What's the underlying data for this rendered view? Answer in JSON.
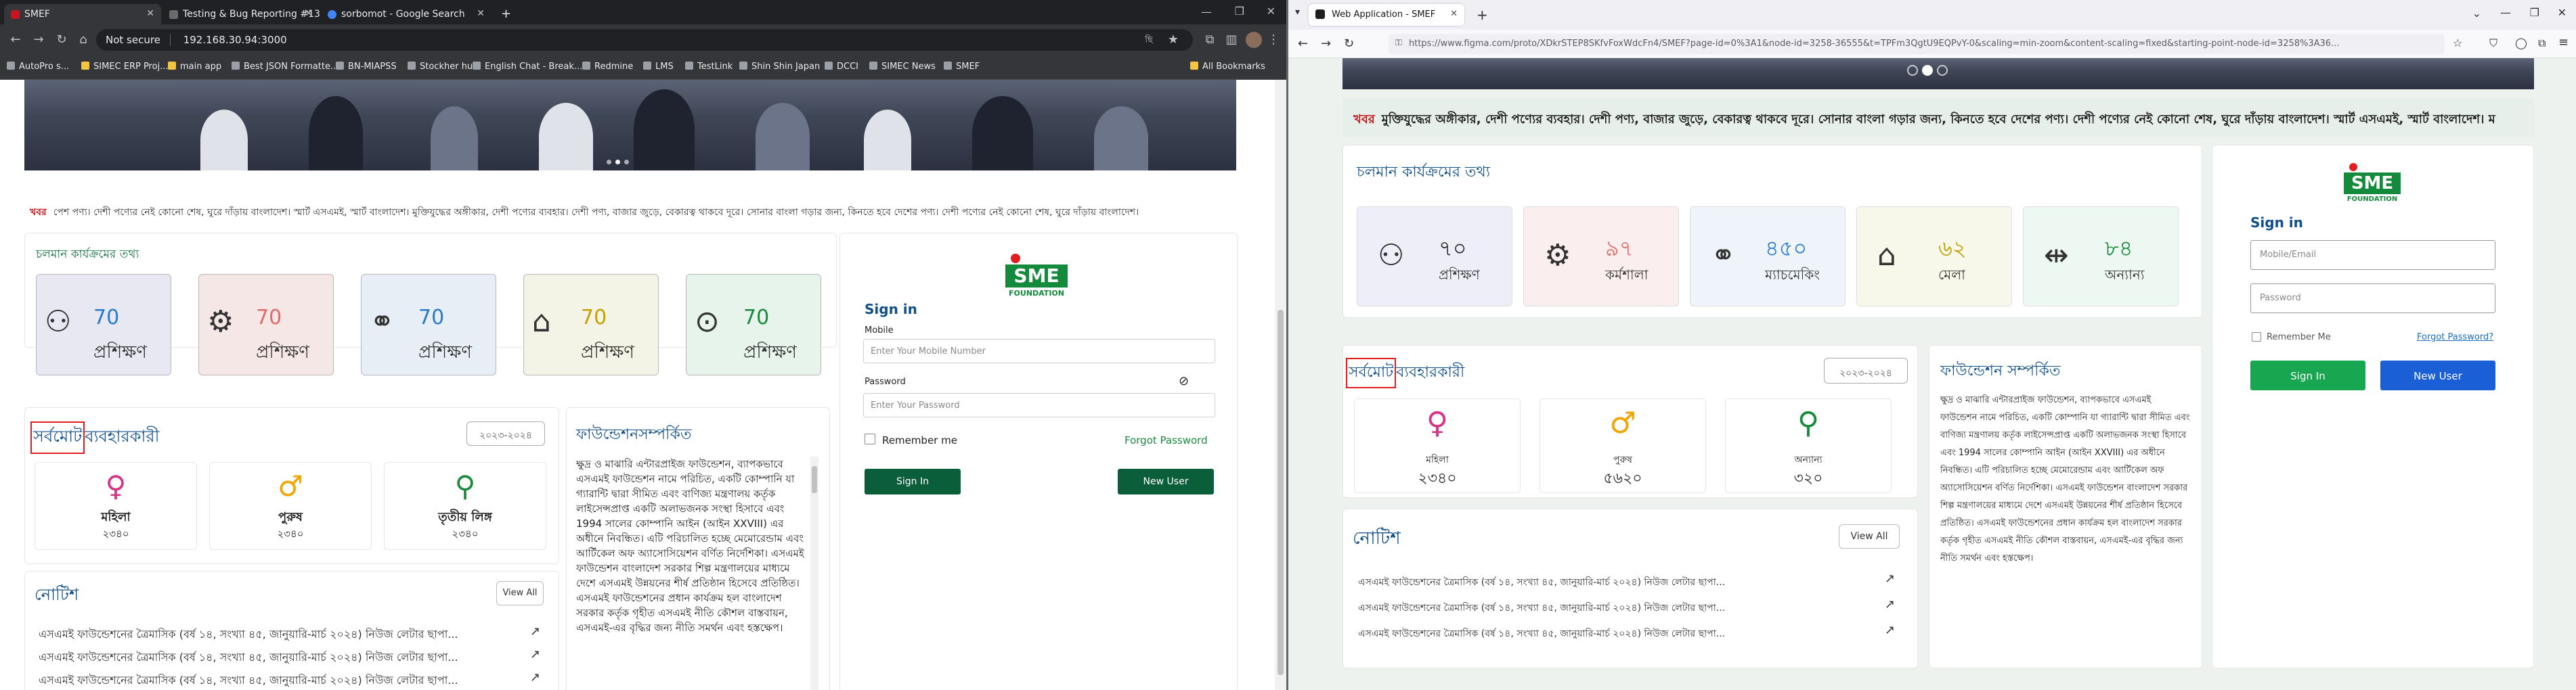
{
  "left_browser": {
    "tabs": [
      {
        "title": "SMEF"
      },
      {
        "title": "Testing & Bug Reporting #130..."
      },
      {
        "title": "sorbomot - Google Search"
      }
    ],
    "address": {
      "security": "Not secure",
      "url": "192.168.30.94:3000"
    },
    "profile": "ছি",
    "bookmarks": [
      "AutoPro s...",
      "SIMEC ERP Proj...",
      "main app",
      "Best JSON Formatte...",
      "BN-MIAPSS",
      "Stockher hub",
      "English Chat - Break...",
      "Redmine",
      "LMS",
      "TestLink",
      "Shin Shin Japan",
      "DCCI",
      "SIMEC News",
      "SMEF"
    ],
    "all_bookmarks": "All Bookmarks"
  },
  "left_page": {
    "ticker_label": "খবর",
    "ticker_text": "পেশ পণ্য। দেশী পণ্যের নেই কোনো শেষ, ঘুরে দাঁড়ায় বাংলাদেশ। স্মার্ট এসএমই, স্মার্ট বাংলাদেশ। মুক্তিযুদ্ধের অঙ্গীকার, দেশী পণ্যের ব্যবহার। দেশী পণ্য, বাজার জুড়ে, বেকারত্ব থাকবে দূরে। সোনার বাংলা গড়ার জন্য, কিনতে হবে দেশের পণ্য। দেশী পণ্যের নেই কোনো শেষ, ঘুরে দাঁড়ায় বাংলাদেশ।",
    "programs_title": "চলমান কার্যক্রমের তথ্য",
    "programs": [
      {
        "icon": "training-icon",
        "value": "70",
        "label": "প্রশিক্ষণ"
      },
      {
        "icon": "workshop-icon",
        "value": "70",
        "label": "প্রশিক্ষণ"
      },
      {
        "icon": "matchmaking-icon",
        "value": "70",
        "label": "প্রশিক্ষণ"
      },
      {
        "icon": "fair-icon",
        "value": "70",
        "label": "প্রশিক্ষণ"
      },
      {
        "icon": "others-icon",
        "value": "70",
        "label": "প্রশিক্ষণ"
      }
    ],
    "users_title_boxed": "সর্বমোট",
    "users_title_rest": "ব্যবহারকারী",
    "year": "২০২৩-২০২৪",
    "stats": [
      {
        "icon": "female-icon",
        "icon_glyph": "♀",
        "label": "মহিলা",
        "value": "২৩৪০",
        "color": "#d63384"
      },
      {
        "icon": "male-icon",
        "icon_glyph": "♂",
        "label": "পুরুষ",
        "value": "২৩৪০",
        "color": "#f0a500"
      },
      {
        "icon": "third-gender-icon",
        "icon_glyph": "⚲",
        "label": "তৃতীয় লিঙ্গ",
        "value": "২৩৪০",
        "color": "#1a8a3d"
      }
    ],
    "notice_title": "নোটিশ",
    "view_all": "View All",
    "notices": [
      "এসএমই ফাউন্ডেশনের ত্রৈমাসিক (বর্ষ ১৪, সংখ্যা ৪৫, জানুয়ারি-মার্চ ২০২৪) নিউজ লেটার ছাপা...",
      "এসএমই ফাউন্ডেশনের ত্রৈমাসিক (বর্ষ ১৪, সংখ্যা ৪৫, জানুয়ারি-মার্চ ২০২৪) নিউজ লেটার ছাপা...",
      "এসএমই ফাউন্ডেশনের ত্রৈমাসিক (বর্ষ ১৪, সংখ্যা ৪৫, জানুয়ারি-মার্চ ২০২৪) নিউজ লেটার ছাপা..."
    ],
    "about_title": "ফাউন্ডেশনসম্পর্কিত",
    "about_text": "ক্ষুদ্র ও মাঝারি এন্টারপ্রাইজ ফাউন্ডেশন, ব্যাপকভাবে এসএমই ফাউন্ডেশন নামে পরিচিত, একটি কোম্পানি যা গ্যারান্টি দ্বারা সীমিত এবং বাণিজ্য মন্ত্রণালয় কর্তৃক লাইসেন্সপ্রাপ্ত একটি অলাভজনক সংস্থা হিসাবে এবং 1994 সালের কোম্পানি আইন (আইন XXVIII) এর অধীনে নিবন্ধিত। এটি পরিচালিত হচ্ছে মেমোরেন্ডাম এবং আর্টিকেল অফ অ্যাসোসিয়েশন বর্ণিত নির্দেশিকা। এসএমই ফাউন্ডেশন বাংলাদেশ সরকার শিল্প মন্ত্রণালয়ের মাধ্যমে দেশে এসএমই উন্নয়নের শীর্ষ প্রতিষ্ঠান হিসেবে প্রতিষ্ঠিত। এসএমই ফাউন্ডেশনের প্রধান কার্যক্রম হল বাংলাদেশ সরকার কর্তৃক গৃহীত এসএমই নীতি কৌশল বাস্তবায়ন, এসএমই-এর বৃদ্ধির জন্য নীতি সমর্থন এবং হস্তক্ষেপ।",
    "signin": {
      "logo_text": "SME",
      "logo_sub": "FOUNDATION",
      "title": "Sign in",
      "mobile_label": "Mobile",
      "mobile_placeholder": "Enter Your Mobile Number",
      "password_label": "Password",
      "password_placeholder": "Enter Your Password",
      "remember": "Remember me",
      "forgot": "Forgot Password",
      "signin_btn": "Sign In",
      "newuser_btn": "New User"
    }
  },
  "right_browser": {
    "tab": "Web Application - SMEF",
    "url": "https://www.figma.com/proto/XDkrSTEP8SKfvFoxWdcFn4/SMEF?page-id=0%3A1&node-id=3258-36555&t=TPFm3QgtU9EQPvY-0&scaling=min-zoom&content-scaling=fixed&starting-point-node-id=3258%3A36..."
  },
  "right_page": {
    "ticker_label": "খবর",
    "ticker_text": "মুক্তিযুদ্ধের অঙ্গীকার, দেশী পণ্যের ব্যবহার। দেশী পণ্য, বাজার জুড়ে, বেকারত্ব থাকবে দূরে। সোনার বাংলা গড়ার জন্য, কিনতে হবে দেশের পণ্য। দেশী পণ্যের নেই কোনো শেষ, ঘুরে দাঁড়ায় বাংলাদেশ। স্মার্ট এসএমই, স্মার্ট বাংলাদেশ। ম",
    "programs_title": "চলমান কার্যক্রমের তথ্য",
    "programs": [
      {
        "icon": "training-icon",
        "value": "৭০",
        "label": "প্রশিক্ষণ",
        "bg": "#eeeef9"
      },
      {
        "icon": "workshop-icon",
        "value": "৯৭",
        "label": "কর্মশালা",
        "bg": "#fbeeee"
      },
      {
        "icon": "matchmaking-icon",
        "value": "৪৫০",
        "label": "ম্যাচমেকিং",
        "bg": "#eef4fa"
      },
      {
        "icon": "fair-icon",
        "value": "৬২",
        "label": "মেলা",
        "bg": "#f7f7ea"
      },
      {
        "icon": "others-icon",
        "value": "৮৪",
        "label": "অন্যান্য",
        "bg": "#eef8f2"
      }
    ],
    "users_title_boxed": "সর্বমোট",
    "users_title_rest": "ব্যবহারকারী",
    "year": "২০২৩-২০২৪",
    "stats": [
      {
        "icon": "female-icon",
        "icon_glyph": "♀",
        "label": "মহিলা",
        "value": "২৩৪০",
        "color": "#d63384"
      },
      {
        "icon": "male-icon",
        "icon_glyph": "♂",
        "label": "পুরুষ",
        "value": "৫৬২০",
        "color": "#f0a500"
      },
      {
        "icon": "third-gender-icon",
        "icon_glyph": "⚲",
        "label": "অন্যান্য",
        "value": "৩২০",
        "color": "#1a8a3d"
      }
    ],
    "notice_title": "নোটিশ",
    "view_all": "View All",
    "notices": [
      "এসএমই ফাউন্ডেশনের ত্রৈমাসিক (বর্ষ ১৪, সংখ্যা ৪৫, জানুয়ারি-মার্চ ২০২৪) নিউজ লেটার ছাপা...",
      "এসএমই ফাউন্ডেশনের ত্রৈমাসিক (বর্ষ ১৪, সংখ্যা ৪৫, জানুয়ারি-মার্চ ২০২৪) নিউজ লেটার ছাপা...",
      "এসএমই ফাউন্ডেশনের ত্রৈমাসিক (বর্ষ ১৪, সংখ্যা ৪৫, জানুয়ারি-মার্চ ২০২৪) নিউজ লেটার ছাপা..."
    ],
    "about_title": "ফাউন্ডেশন সম্পর্কিত",
    "about_text": "ক্ষুদ্র ও মাঝারি এন্টারপ্রাইজ ফাউন্ডেশন, ব্যাপকভাবে এসএমই ফাউন্ডেশন নামে পরিচিত, একটি কোম্পানি যা গ্যারান্টি দ্বারা সীমিত এবং বাণিজ্য মন্ত্রণালয় কর্তৃক লাইসেন্সপ্রাপ্ত একটি অলাভজনক সংস্থা হিসাবে এবং 1994 সালের কোম্পানি আইন (আইন XXVIII) এর অধীনে নিবন্ধিত। এটি পরিচালিত হচ্ছে মেমোরেন্ডাম এবং আর্টিকেল অফ অ্যাসোসিয়েশন বর্ণিত নির্দেশিকা। এসএমই ফাউন্ডেশন বাংলাদেশ সরকার শিল্প মন্ত্রণালয়ের মাধ্যমে দেশে এসএমই উন্নয়নের শীর্ষ প্রতিষ্ঠান হিসেবে প্রতিষ্ঠিত। এসএমই ফাউন্ডেশনের প্রধান কার্যক্রম হল বাংলাদেশ সরকার কর্তৃক গৃহীত এসএমই নীতি কৌশল বাস্তবায়ন, এসএমই-এর বৃদ্ধির জন্য নীতি সমর্থন এবং হস্তক্ষেপ।",
    "signin": {
      "logo_text": "SME",
      "logo_sub": "FOUNDATION",
      "title": "Sign in",
      "mobile_placeholder": "Mobile/Email",
      "password_placeholder": "Password",
      "remember": "Remember Me",
      "forgot": "Forgot Password?",
      "signin_btn": "Sign In",
      "newuser_btn": "New User"
    }
  }
}
